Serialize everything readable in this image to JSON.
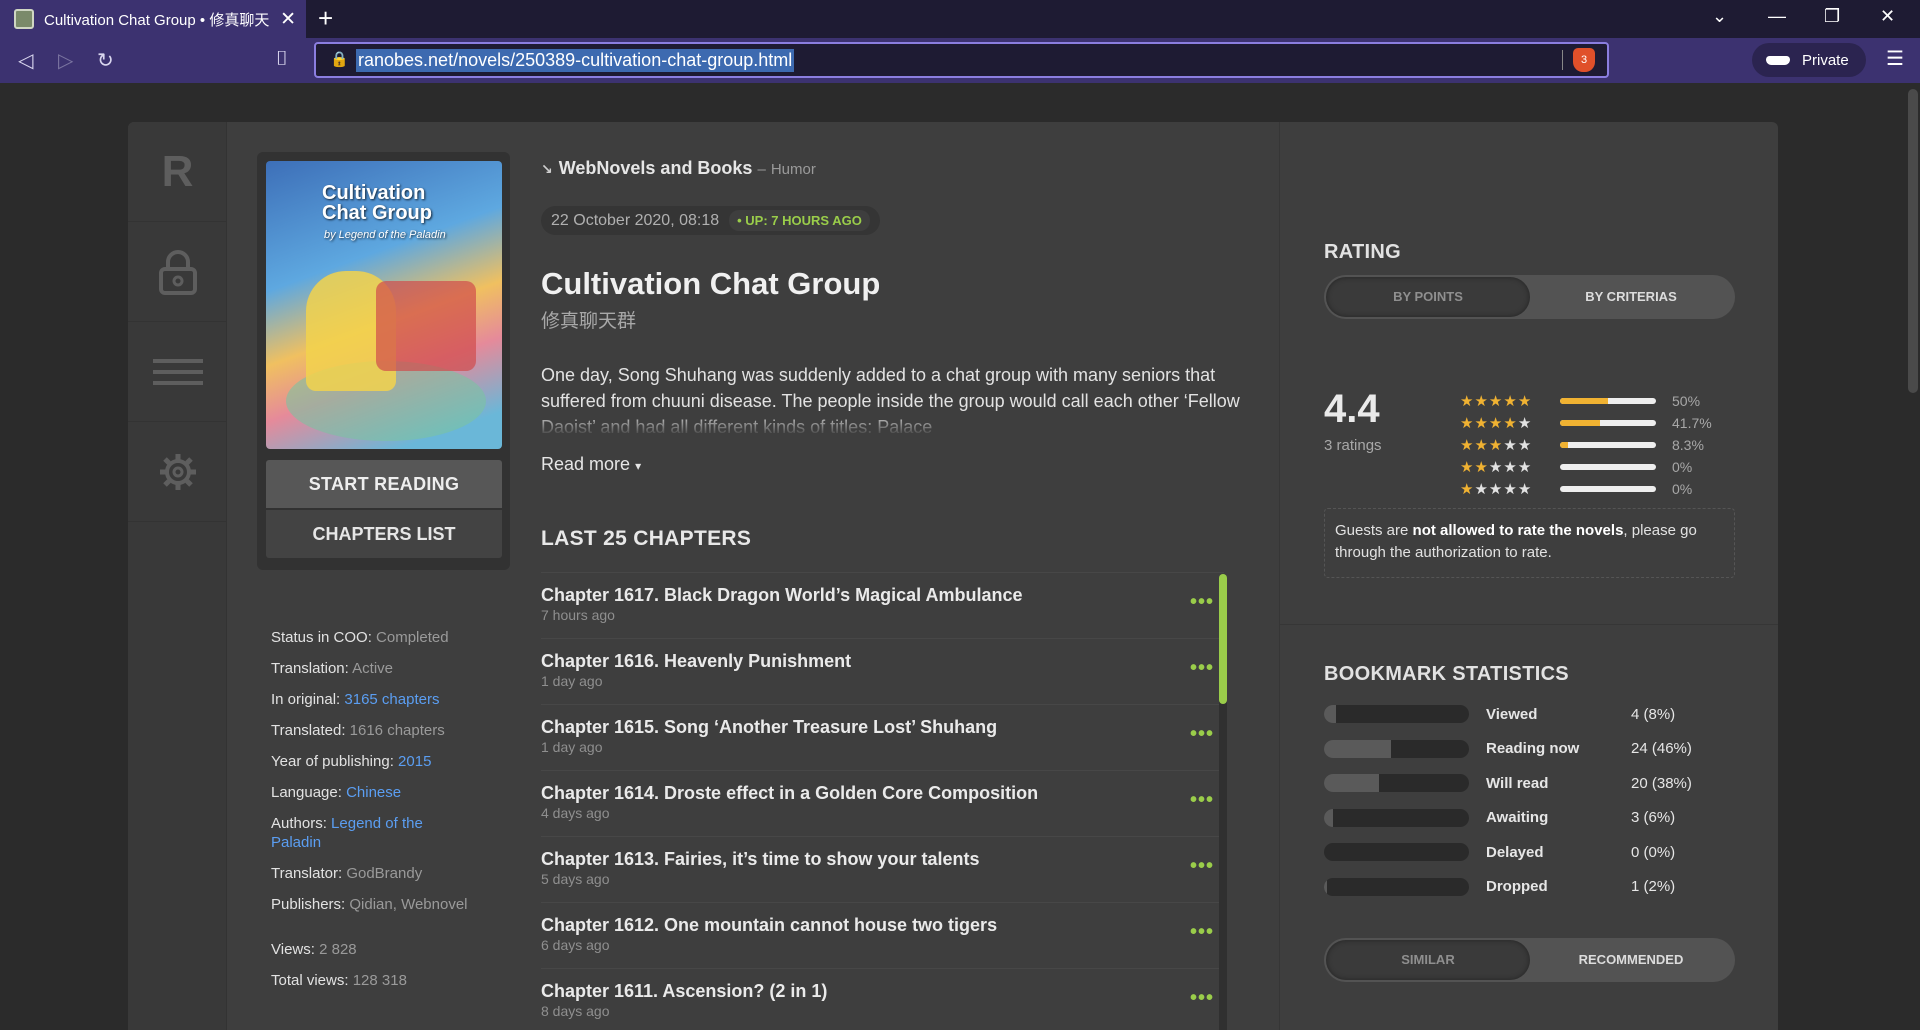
{
  "browser": {
    "tab_title": "Cultivation Chat Group • 修真聊天",
    "url": "ranobes.net/novels/250389-cultivation-chat-group.html",
    "brave_badge": "3",
    "private_label": "Private"
  },
  "nav": {
    "logo": "R"
  },
  "cover": {
    "title_line1": "Cultivation",
    "title_line2": "Chat Group",
    "byline": "by Legend of the Paladin"
  },
  "actions": {
    "start_reading": "START READING",
    "chapters_list": "CHAPTERS LIST"
  },
  "info": {
    "status_label": "Status in COO:",
    "status_value": "Completed",
    "translation_label": "Translation:",
    "translation_value": "Active",
    "original_label": "In original:",
    "original_value": "3165 chapters",
    "translated_label": "Translated:",
    "translated_value": "1616 chapters",
    "year_label": "Year of publishing:",
    "year_value": "2015",
    "language_label": "Language:",
    "language_value": "Chinese",
    "authors_label": "Authors:",
    "authors_value": "Legend of the Paladin",
    "translator_label": "Translator:",
    "translator_value": "GodBrandy",
    "publishers_label": "Publishers:",
    "publishers_value": "Qidian, Webnovel",
    "views_label": "Views:",
    "views_value": "2 828",
    "total_views_label": "Total views:",
    "total_views_value": "128 318"
  },
  "novel": {
    "breadcrumb": "WebNovels and Books",
    "genre_sep": "–",
    "genre": "Humor",
    "date": "22 October 2020, 08:18",
    "updated": "UP: 7 HOURS AGO",
    "title": "Cultivation Chat Group",
    "original_title": "修真聊天群",
    "description": "One day, Song Shuhang was suddenly added to a chat group with many seniors that suffered from chuuni disease. The people inside the group would call each other ‘Fellow Daoist’ and had all different kinds of titles: Palace",
    "read_more": "Read more"
  },
  "chapters": {
    "heading": "LAST 25 CHAPTERS",
    "more": "•••",
    "items": [
      {
        "title": "Chapter 1617. Black Dragon World’s Magical Ambulance",
        "time": "7 hours ago"
      },
      {
        "title": "Chapter 1616. Heavenly Punishment",
        "time": "1 day ago"
      },
      {
        "title": "Chapter 1615. Song ‘Another Treasure Lost’ Shuhang",
        "time": "1 day ago"
      },
      {
        "title": "Chapter 1614. Droste effect in a Golden Core Composition",
        "time": "4 days ago"
      },
      {
        "title": "Chapter 1613. Fairies, it’s time to show your talents",
        "time": "5 days ago"
      },
      {
        "title": "Chapter 1612. One mountain cannot house two tigers",
        "time": "6 days ago"
      },
      {
        "title": "Chapter 1611. Ascension? (2 in 1)",
        "time": "8 days ago"
      }
    ]
  },
  "rating": {
    "heading": "RATING",
    "tab_points": "BY POINTS",
    "tab_criterias": "BY CRITERIAS",
    "score": "4.4",
    "count": "3 ratings",
    "distribution": [
      {
        "stars": 5,
        "percent": 50,
        "label": "50%"
      },
      {
        "stars": 4,
        "percent": 41.7,
        "label": "41.7%"
      },
      {
        "stars": 3,
        "percent": 8.3,
        "label": "8.3%"
      },
      {
        "stars": 2,
        "percent": 0,
        "label": "0%"
      },
      {
        "stars": 1,
        "percent": 0,
        "label": "0%"
      }
    ],
    "guest_note_pre": "Guests are ",
    "guest_note_bold": "not allowed to rate the novels",
    "guest_note_post": ", please go through the authorization to rate."
  },
  "bookmarks": {
    "heading": "BOOKMARK STATISTICS",
    "items": [
      {
        "label": "Viewed",
        "value": "4 (8%)",
        "percent": 8
      },
      {
        "label": "Reading now",
        "value": "24 (46%)",
        "percent": 46
      },
      {
        "label": "Will read",
        "value": "20 (38%)",
        "percent": 38
      },
      {
        "label": "Awaiting",
        "value": "3 (6%)",
        "percent": 6
      },
      {
        "label": "Delayed",
        "value": "0 (0%)",
        "percent": 0
      },
      {
        "label": "Dropped",
        "value": "1 (2%)",
        "percent": 2
      }
    ]
  },
  "similar": {
    "tab_similar": "SIMILAR",
    "tab_recommended": "RECOMMENDED"
  },
  "colors": {
    "accent_green": "#9acd4a",
    "star": "#f0b232",
    "link": "#5b9ef2",
    "browser": "#3c3270"
  },
  "icons": [
    "lock-icon",
    "menu-icon",
    "gear-icon",
    "back-icon",
    "forward-icon",
    "reload-icon",
    "bookmark-icon"
  ]
}
